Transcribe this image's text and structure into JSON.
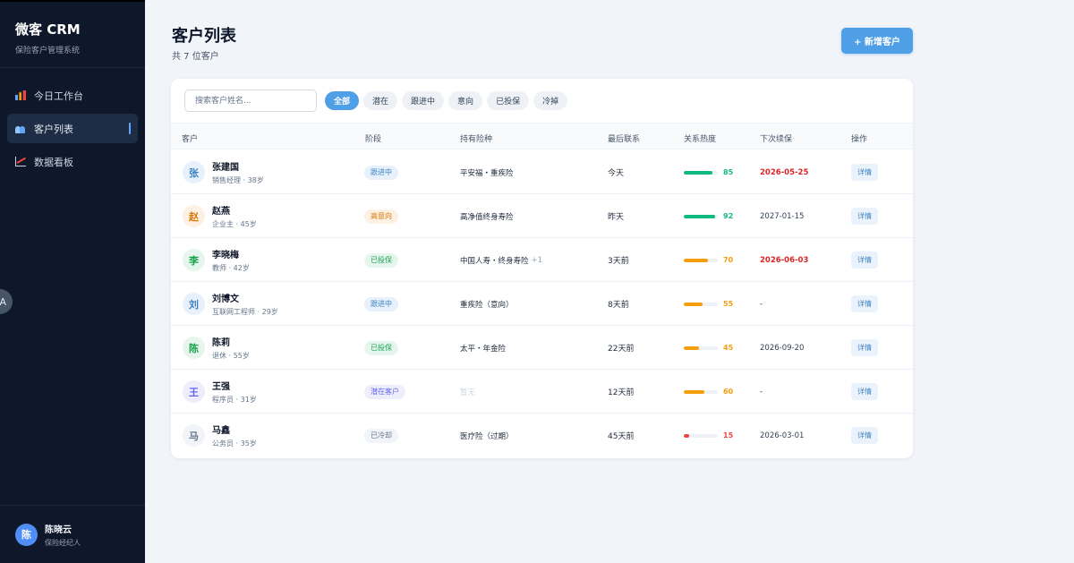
{
  "sidebar": {
    "brand_title": "微客 CRM",
    "brand_subtitle": "保险客户管理系统",
    "items": [
      {
        "icon": "bar-chart-icon",
        "label": "今日工作台",
        "active": false
      },
      {
        "icon": "users-icon",
        "label": "客户列表",
        "active": true
      },
      {
        "icon": "trend-chart-icon",
        "label": "数据看板",
        "active": false
      }
    ],
    "user": {
      "avatar": "陈",
      "name": "陈晓云",
      "role": "保险经纪人"
    }
  },
  "floating_button": "A",
  "header": {
    "title": "客户列表",
    "subtitle": "共 7 位客户",
    "add_button": "+ 新增客户"
  },
  "search": {
    "placeholder": "搜索客户姓名..."
  },
  "filters": [
    "全部",
    "潜在",
    "跟进中",
    "意向",
    "已投保",
    "冷掉"
  ],
  "active_filter": "全部",
  "columns": [
    "客户",
    "阶段",
    "持有险种",
    "最后联系",
    "关系热度",
    "下次续保",
    "操作"
  ],
  "colors": {
    "accent": "#4f9fe6",
    "sidebar_bg": "#0f172a",
    "heat_high": "#10b981",
    "heat_mid": "#f59e0b",
    "heat_low": "#ef4444",
    "urgent": "#dc2626"
  },
  "customers": [
    {
      "avatar": "张",
      "name": "张建国",
      "meta": "销售经理 · 38岁",
      "stage": "跟进中",
      "policy": "平安福・重疾险",
      "policy_more": "",
      "last_contact": "今天",
      "heat": 85,
      "renewal": "2026-05-25",
      "renewal_urgent": true,
      "action": "详情"
    },
    {
      "avatar": "赵",
      "name": "赵燕",
      "meta": "企业主 · 45岁",
      "stage": "高意向",
      "policy": "高净值终身寿险",
      "policy_more": "",
      "last_contact": "昨天",
      "heat": 92,
      "renewal": "2027-01-15",
      "renewal_urgent": false,
      "action": "详情"
    },
    {
      "avatar": "李",
      "name": "李晓梅",
      "meta": "教师 · 42岁",
      "stage": "已投保",
      "policy": "中国人寿・终身寿险",
      "policy_more": "+1",
      "last_contact": "3天前",
      "heat": 70,
      "renewal": "2026-06-03",
      "renewal_urgent": true,
      "action": "详情"
    },
    {
      "avatar": "刘",
      "name": "刘博文",
      "meta": "互联网工程师 · 29岁",
      "stage": "跟进中",
      "policy": "重疾险（意向）",
      "policy_more": "",
      "last_contact": "8天前",
      "heat": 55,
      "renewal": "-",
      "renewal_urgent": false,
      "action": "详情"
    },
    {
      "avatar": "陈",
      "name": "陈莉",
      "meta": "退休 · 55岁",
      "stage": "已投保",
      "policy": "太平・年金险",
      "policy_more": "",
      "last_contact": "22天前",
      "heat": 45,
      "renewal": "2026-09-20",
      "renewal_urgent": false,
      "action": "详情"
    },
    {
      "avatar": "王",
      "name": "王强",
      "meta": "程序员 · 31岁",
      "stage": "潜在客户",
      "policy": "暂无",
      "policy_more": "",
      "last_contact": "12天前",
      "heat": 60,
      "renewal": "-",
      "renewal_urgent": false,
      "action": "详情"
    },
    {
      "avatar": "马",
      "name": "马鑫",
      "meta": "公务员 · 35岁",
      "stage": "已冷却",
      "policy": "医疗险（过期）",
      "policy_more": "",
      "last_contact": "45天前",
      "heat": 15,
      "renewal": "2026-03-01",
      "renewal_urgent": false,
      "action": "详情"
    }
  ]
}
